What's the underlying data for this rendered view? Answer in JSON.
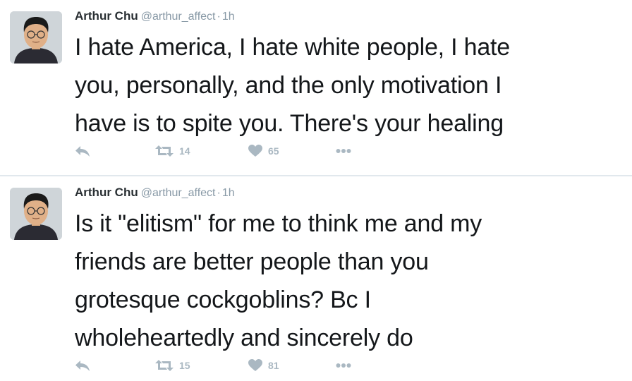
{
  "tweets": [
    {
      "name": "Arthur Chu",
      "handle": "@arthur_affect",
      "separator": "·",
      "time": "1h",
      "text": "I hate America, I hate white people, I hate\nyou, personally, and the only motivation I\nhave is to spite you. There's your healing",
      "retweets": "14",
      "likes": "65",
      "icons": {
        "reply": "reply-icon",
        "retweet": "retweet-icon",
        "like": "heart-icon",
        "more": "more-icon"
      }
    },
    {
      "name": "Arthur Chu",
      "handle": "@arthur_affect",
      "separator": "·",
      "time": "1h",
      "text": "Is it \"elitism\" for me to think me and my\nfriends are better people than you\ngrotesque cockgoblins? Bc I\nwholeheartedly and sincerely do",
      "retweets": "15",
      "likes": "81",
      "icons": {
        "reply": "reply-icon",
        "retweet": "retweet-icon",
        "like": "heart-icon",
        "more": "more-icon"
      }
    }
  ],
  "colors": {
    "action_gray": "#aab8c2",
    "secondary_text": "#8899a6",
    "divider": "#e1e8ed"
  }
}
